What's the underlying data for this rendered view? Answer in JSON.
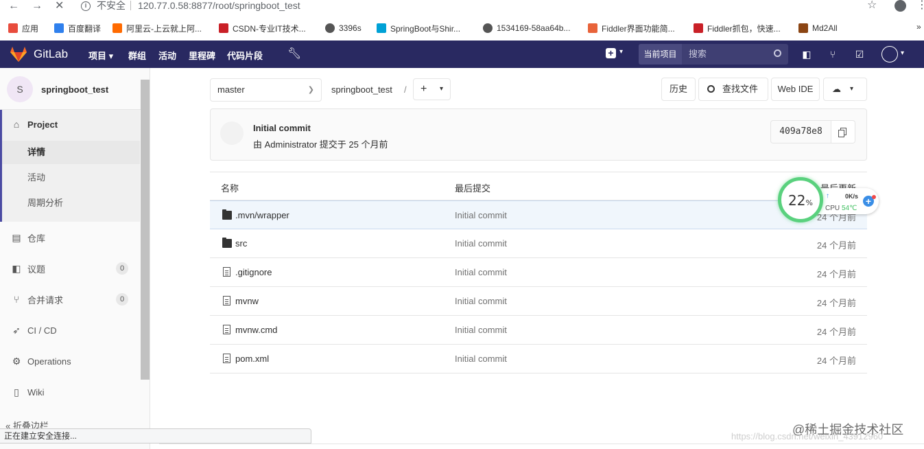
{
  "browser": {
    "insecure_label": "不安全",
    "url": "120.77.0.58:8877/root/springboot_test",
    "bookmarks": [
      {
        "label": "应用",
        "color": "#e84c3d"
      },
      {
        "label": "百度翻译",
        "color": "#2f80ed"
      },
      {
        "label": "阿里云-上云就上阿...",
        "color": "#ff6a00"
      },
      {
        "label": "CSDN-专业IT技术...",
        "color": "#c92027"
      },
      {
        "label": "3396s",
        "color": "#555555"
      },
      {
        "label": "SpringBoot与Shir...",
        "color": "#00a1d6"
      },
      {
        "label": "1534169-58aa64b...",
        "color": "#555555"
      },
      {
        "label": "Fiddler界面功能简...",
        "color": "#e8633a"
      },
      {
        "label": "Fiddler抓包，快速...",
        "color": "#c92027"
      },
      {
        "label": "Md2All",
        "color": "#8b4513"
      }
    ],
    "more": "»"
  },
  "header": {
    "brand": "GitLab",
    "nav": [
      "项目 ▾",
      "群组",
      "活动",
      "里程碑",
      "代码片段"
    ],
    "search_scope": "当前项目",
    "search_placeholder": "搜索",
    "brand_color": "#292961"
  },
  "sidebar": {
    "project_initial": "S",
    "project_name": "springboot_test",
    "section_title": "Project",
    "sub_items": [
      "详情",
      "活动",
      "周期分析"
    ],
    "items": [
      {
        "label": "仓库",
        "icon": "book-icon"
      },
      {
        "label": "议题",
        "icon": "issues-icon",
        "badge": "0"
      },
      {
        "label": "合并请求",
        "icon": "merge-request-icon",
        "badge": "0"
      },
      {
        "label": "CI / CD",
        "icon": "rocket-icon"
      },
      {
        "label": "Operations",
        "icon": "cloud-gear-icon"
      },
      {
        "label": "Wiki",
        "icon": "wiki-icon"
      }
    ],
    "collapse_label": "折叠边栏"
  },
  "repo": {
    "branch": "master",
    "breadcrumb": "springboot_test",
    "breadcrumb_sep": "/",
    "buttons": {
      "history": "历史",
      "find_file": "查找文件",
      "web_ide": "Web IDE"
    }
  },
  "commit": {
    "title": "Initial commit",
    "meta": "由 Administrator 提交于 25 个月前",
    "sha": "409a78e8"
  },
  "table": {
    "headers": {
      "name": "名称",
      "last_commit": "最后提交",
      "last_update": "最后更新"
    },
    "rows": [
      {
        "name": ".mvn/wrapper",
        "type": "folder",
        "commit": "Initial commit",
        "time": "24 个月前"
      },
      {
        "name": "src",
        "type": "folder",
        "commit": "Initial commit",
        "time": "24 个月前"
      },
      {
        "name": ".gitignore",
        "type": "file",
        "commit": "Initial commit",
        "time": "24 个月前"
      },
      {
        "name": "mvnw",
        "type": "file",
        "commit": "Initial commit",
        "time": "24 个月前"
      },
      {
        "name": "mvnw.cmd",
        "type": "file",
        "commit": "Initial commit",
        "time": "24 个月前"
      },
      {
        "name": "pom.xml",
        "type": "file",
        "commit": "Initial commit",
        "time": "24 个月前"
      }
    ]
  },
  "cpu_widget": {
    "percent": "22",
    "percent_unit": "%",
    "speed": "0K/s",
    "cpu_label": "CPU",
    "temp": "54℃"
  },
  "status_bar": "正在建立安全连接...",
  "watermark": {
    "line1": "@稀土掘金技术社区",
    "line2": "https://blog.csdn.net/weixin_43912960"
  }
}
